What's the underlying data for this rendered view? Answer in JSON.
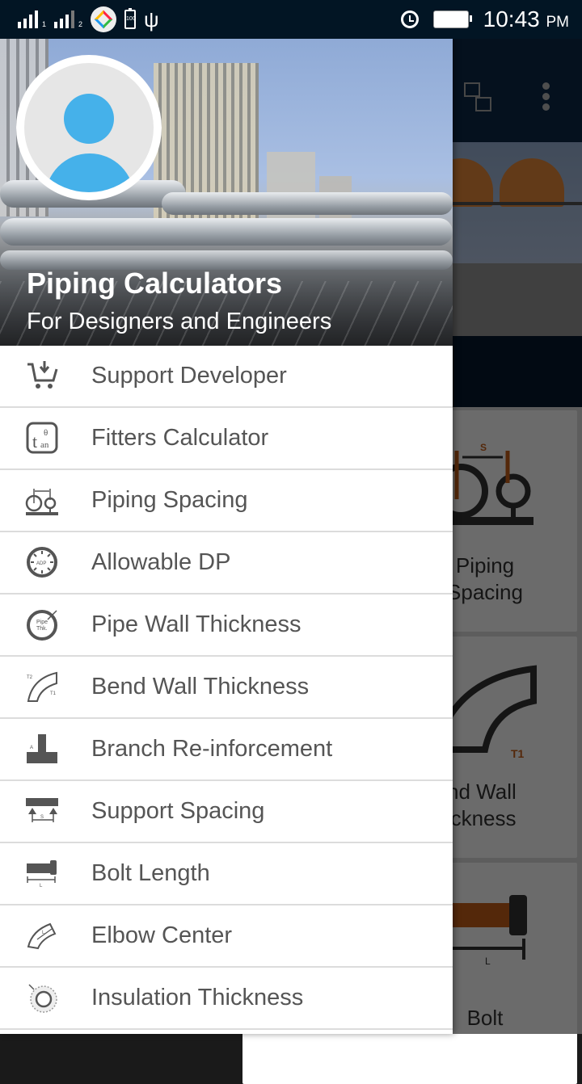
{
  "status_bar": {
    "sim1_label": "1",
    "sim2_label": "2",
    "battery_small_label": "100",
    "time": "10:43",
    "am_pm": "PM",
    "icons": [
      "signal-sim1-icon",
      "signal-sim2-icon",
      "app-notification-icon",
      "battery-saver-icon",
      "usb-icon",
      "alarm-icon",
      "battery-icon"
    ]
  },
  "drawer": {
    "header": {
      "title": "Piping Calculators",
      "subtitle": "For Designers and Engineers",
      "avatar": "default-user-avatar"
    },
    "items": [
      {
        "label": "Support Developer",
        "icon": "cart-download-icon"
      },
      {
        "label": "Fitters Calculator",
        "icon": "tan-theta-icon"
      },
      {
        "label": "Piping Spacing",
        "icon": "pipe-spacing-icon"
      },
      {
        "label": "Allowable DP",
        "icon": "pressure-gauge-icon"
      },
      {
        "label": "Pipe Wall Thickness",
        "icon": "pipe-thickness-icon"
      },
      {
        "label": "Bend Wall Thickness",
        "icon": "bend-thickness-icon"
      },
      {
        "label": "Branch Re-inforcement",
        "icon": "branch-tee-icon"
      },
      {
        "label": "Support Spacing",
        "icon": "support-spacing-icon"
      },
      {
        "label": "Bolt Length",
        "icon": "bolt-icon"
      },
      {
        "label": "Elbow Center",
        "icon": "elbow-icon"
      },
      {
        "label": "Insulation Thickness",
        "icon": "insulation-icon"
      }
    ]
  },
  "background_app": {
    "toolbar_icons": [
      "feedback-thumbs-icon",
      "more-vert-icon"
    ],
    "cards": [
      {
        "label_line1": "Piping",
        "label_line2": "Spacing"
      },
      {
        "label_line1": "Bend Wall",
        "label_line2": "Thickness"
      },
      {
        "label_line1": "Bolt",
        "label_line2": ""
      }
    ]
  },
  "colors": {
    "status_bar": "#021524",
    "toolbar": "#0e2a48",
    "avatar_accent": "#45b1ea",
    "menu_text": "#555555",
    "divider": "#dcdcdc",
    "diagram_accent": "#c8601a"
  }
}
